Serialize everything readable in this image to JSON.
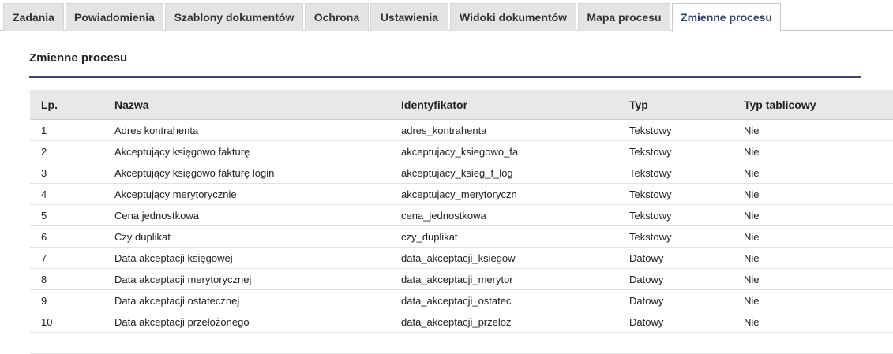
{
  "tabs": [
    {
      "label": "Zadania",
      "active": false
    },
    {
      "label": "Powiadomienia",
      "active": false
    },
    {
      "label": "Szablony dokumentów",
      "active": false
    },
    {
      "label": "Ochrona",
      "active": false
    },
    {
      "label": "Ustawienia",
      "active": false
    },
    {
      "label": "Widoki dokumentów",
      "active": false
    },
    {
      "label": "Mapa procesu",
      "active": false
    },
    {
      "label": "Zmienne procesu",
      "active": true
    }
  ],
  "section": {
    "title": "Zmienne procesu"
  },
  "table": {
    "headers": {
      "lp": "Lp.",
      "name": "Nazwa",
      "id": "Identyfikator",
      "type": "Typ",
      "table_type": "Typ tablicowy"
    },
    "rows": [
      {
        "lp": "1",
        "name": "Adres kontrahenta",
        "id": "adres_kontrahenta",
        "type": "Tekstowy",
        "table_type": "Nie"
      },
      {
        "lp": "2",
        "name": "Akceptujący księgowo fakturę",
        "id": "akceptujacy_ksiegowo_fa",
        "type": "Tekstowy",
        "table_type": "Nie"
      },
      {
        "lp": "3",
        "name": "Akceptujący księgowo fakturę login",
        "id": "akceptujacy_ksieg_f_log",
        "type": "Tekstowy",
        "table_type": "Nie"
      },
      {
        "lp": "4",
        "name": "Akceptujący merytorycznie",
        "id": "akceptujacy_merytoryczn",
        "type": "Tekstowy",
        "table_type": "Nie"
      },
      {
        "lp": "5",
        "name": "Cena jednostkowa",
        "id": "cena_jednostkowa",
        "type": "Tekstowy",
        "table_type": "Nie"
      },
      {
        "lp": "6",
        "name": "Czy duplikat",
        "id": "czy_duplikat",
        "type": "Tekstowy",
        "table_type": "Nie"
      },
      {
        "lp": "7",
        "name": "Data akceptacji księgowej",
        "id": "data_akceptacji_ksiegow",
        "type": "Datowy",
        "table_type": "Nie"
      },
      {
        "lp": "8",
        "name": "Data akceptacji merytorycznej",
        "id": "data_akceptacji_merytor",
        "type": "Datowy",
        "table_type": "Nie"
      },
      {
        "lp": "9",
        "name": "Data akceptacji ostatecznej",
        "id": "data_akceptacji_ostatec",
        "type": "Datowy",
        "table_type": "Nie"
      },
      {
        "lp": "10",
        "name": "Data akceptacji przełożonego",
        "id": "data_akceptacji_przeloz",
        "type": "Datowy",
        "table_type": "Nie"
      }
    ]
  }
}
